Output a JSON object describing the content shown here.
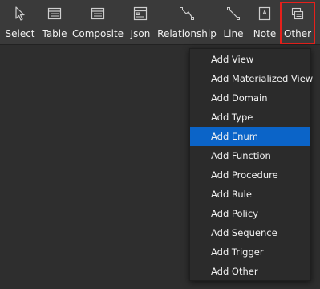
{
  "toolbar": {
    "tools": [
      {
        "label": "Select",
        "icon": "cursor-icon"
      },
      {
        "label": "Table",
        "icon": "table-icon"
      },
      {
        "label": "Composite",
        "icon": "composite-icon"
      },
      {
        "label": "Json",
        "icon": "json-icon"
      },
      {
        "label": "Relationship",
        "icon": "relationship-icon"
      },
      {
        "label": "Line",
        "icon": "line-icon"
      },
      {
        "label": "Note",
        "icon": "note-icon"
      },
      {
        "label": "Other",
        "icon": "other-icon"
      }
    ],
    "highlight_color": "#e5201b"
  },
  "menu": {
    "items": [
      "Add View",
      "Add Materialized View",
      "Add Domain",
      "Add Type",
      "Add Enum",
      "Add Function",
      "Add Procedure",
      "Add Rule",
      "Add Policy",
      "Add Sequence",
      "Add Trigger",
      "Add Other"
    ],
    "selected": "Add Enum",
    "selected_color": "#0b64c8"
  }
}
